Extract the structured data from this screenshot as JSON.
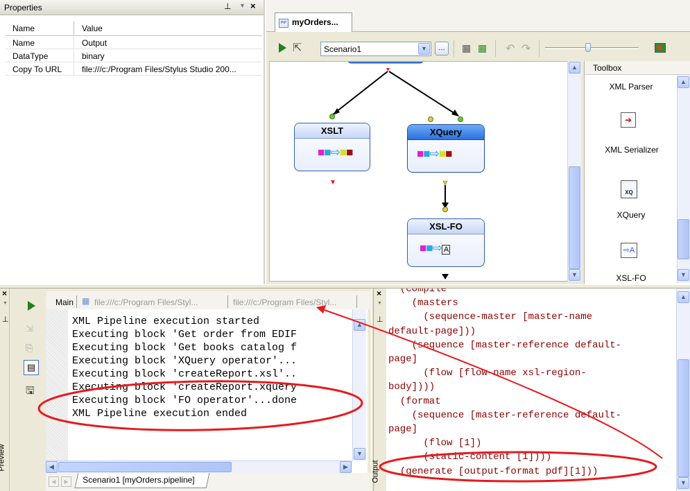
{
  "properties": {
    "title": "Properties",
    "pin": "p",
    "columns": [
      "Name",
      "Value"
    ],
    "rows": [
      {
        "name": "Name",
        "value": "Output"
      },
      {
        "name": "DataType",
        "value": "binary"
      },
      {
        "name": "Copy To URL",
        "value": "file:///c:/Program Files/Stylus Studio 200..."
      }
    ]
  },
  "editor": {
    "tab": "myOrders...",
    "tab_icon": "PIP",
    "scenario": "Scenario1"
  },
  "canvas": {
    "blocks": {
      "xslt": "XSLT",
      "xquery": "XQuery",
      "xslfo": "XSL-FO"
    }
  },
  "toolbox": {
    "title": "Toolbox",
    "items": [
      "XML Parser",
      "XML Serializer",
      "XQuery",
      "XSL-FO"
    ],
    "xq_badge": "XQ"
  },
  "preview": {
    "side_label": "Preview",
    "tabs": [
      "Main",
      "file:///c:/Program Files/Styl...",
      "file:///c:/Program Files/Styl..."
    ],
    "log": [
      "XML Pipeline execution started",
      "Executing block 'Get order from EDIF",
      "Executing block 'Get books catalog f",
      "Executing block 'XQuery operator'...",
      "Executing block 'createReport.xsl'..",
      "Executing block 'createReport.xquery",
      "Executing block 'FO operator'...done",
      "XML Pipeline execution ended"
    ],
    "bottom_tab": "Scenario1 [myOrders.pipeline]"
  },
  "output": {
    "side_label": "Output",
    "lines": [
      "  (compile",
      "    (masters",
      "      (sequence-master [master-name",
      "default-page]))",
      "    (sequence [master-reference default-",
      "page]",
      "      (flow [flow-name xsl-region-",
      "body])))",
      "  (format",
      "    (sequence [master-reference default-",
      "page]",
      "      (flow [1])",
      "      (static-content [1])))",
      "  (generate [output-format pdf][1]))"
    ]
  },
  "colors": {
    "annotation": "#e8191d",
    "xml_text": "#8b0000",
    "block_header": "#3a84e8",
    "panel_bg": "#ece9d8"
  }
}
